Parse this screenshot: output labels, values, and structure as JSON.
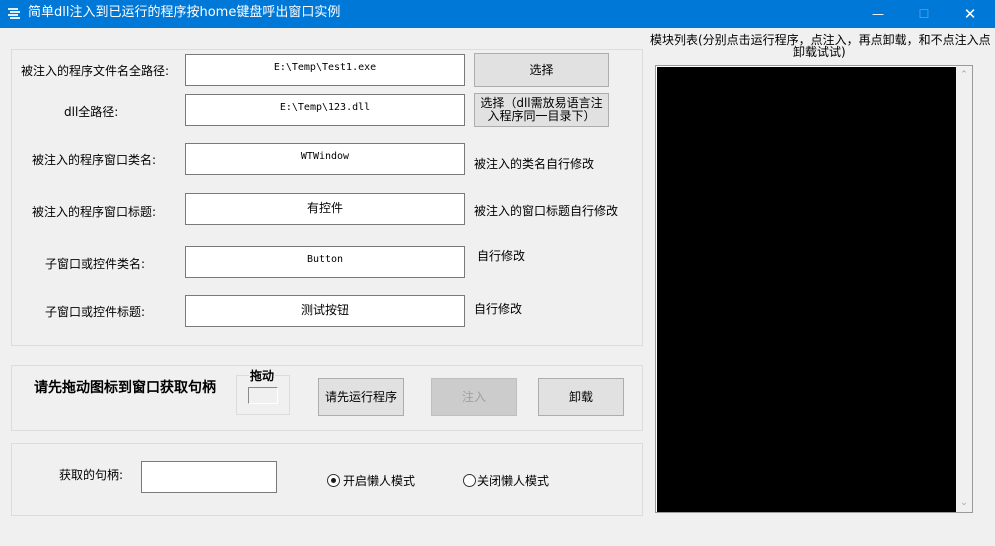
{
  "window": {
    "title": "简单dll注入到已运行的程序按home键盘呼出窗口实例",
    "minimize_glyph": "—",
    "maximize_glyph": "☐",
    "close_glyph": "✕"
  },
  "form": {
    "exe_path_label": "被注入的程序文件名全路径:",
    "exe_path_value": "E:\\Temp\\Test1.exe",
    "select_exe_button": "选择",
    "dll_path_label": "dll全路径:",
    "dll_path_value": "E:\\Temp\\123.dll",
    "select_dll_button_line1": "选择（dll需放易语言注",
    "select_dll_button_line2": "入程序同一目录下）",
    "window_class_label": "被注入的程序窗口类名:",
    "window_class_value": "WTWindow",
    "window_class_hint": "被注入的类名自行修改",
    "window_title_label": "被注入的程序窗口标题:",
    "window_title_value": "有控件",
    "window_title_hint": "被注入的窗口标题自行修改",
    "child_class_label": "子窗口或控件类名:",
    "child_class_value": "Button",
    "child_class_hint": "自行修改",
    "child_title_label": "子窗口或控件标题:",
    "child_title_value": "测试按钮",
    "child_title_hint": "自行修改"
  },
  "actions": {
    "drag_instruction": "请先拖动图标到窗口获取句柄",
    "drag_label": "拖动",
    "run_first_button": "请先运行程序",
    "inject_button": "注入",
    "uninstall_button": "卸载"
  },
  "handle": {
    "label": "获取的句柄:",
    "value": "",
    "lazy_on_label": "开启懒人模式",
    "lazy_off_label": "关闭懒人模式",
    "lazy_mode_selected": "开启懒人模式"
  },
  "module_list": {
    "title_line1": "模块列表(分别点击运行程序，点注入，再点卸载，和不点注入点",
    "title_line2": "卸载试试)",
    "items": []
  },
  "colors": {
    "titlebar": "#0078d7",
    "window_bg": "#f0f0f0",
    "list_bg": "#000000"
  }
}
